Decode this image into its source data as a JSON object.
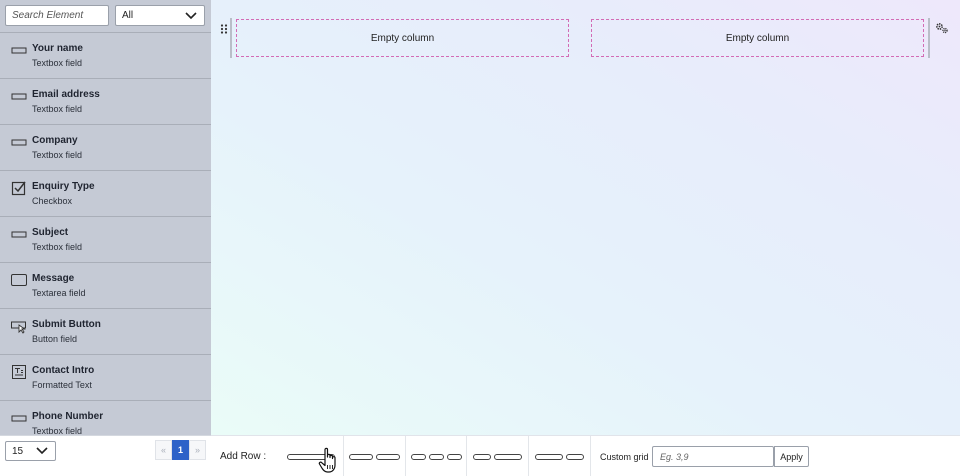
{
  "sidebar": {
    "search_placeholder": "Search Element",
    "filter_value": "All",
    "items": [
      {
        "name": "Your name",
        "type": "Textbox field",
        "icon": "textbox-icon"
      },
      {
        "name": "Email address",
        "type": "Textbox field",
        "icon": "textbox-icon"
      },
      {
        "name": "Company",
        "type": "Textbox field",
        "icon": "textbox-icon"
      },
      {
        "name": "Enquiry Type",
        "type": "Checkbox",
        "icon": "checkbox-icon"
      },
      {
        "name": "Subject",
        "type": "Textbox field",
        "icon": "textbox-icon"
      },
      {
        "name": "Message",
        "type": "Textarea field",
        "icon": "textarea-icon"
      },
      {
        "name": "Submit Button",
        "type": "Button field",
        "icon": "button-icon"
      },
      {
        "name": "Contact Intro",
        "type": "Formatted Text",
        "icon": "formatted-text-icon"
      },
      {
        "name": "Phone Number",
        "type": "Textbox field",
        "icon": "textbox-icon"
      }
    ],
    "footer": {
      "page_size": "15",
      "prev": "«",
      "current_page": "1",
      "next": "»"
    }
  },
  "canvas": {
    "columns": [
      {
        "label": "Empty column"
      },
      {
        "label": "Empty column"
      }
    ]
  },
  "toolbar": {
    "add_row_label": "Add Row :",
    "custom_grid_label": "Custom grid",
    "custom_grid_placeholder": "Eg. 3,9",
    "apply_label": "Apply"
  },
  "colors": {
    "sidebar_bg": "#c5cad5",
    "column_border": "#d36bb5",
    "pager_active": "#2d62c8"
  }
}
